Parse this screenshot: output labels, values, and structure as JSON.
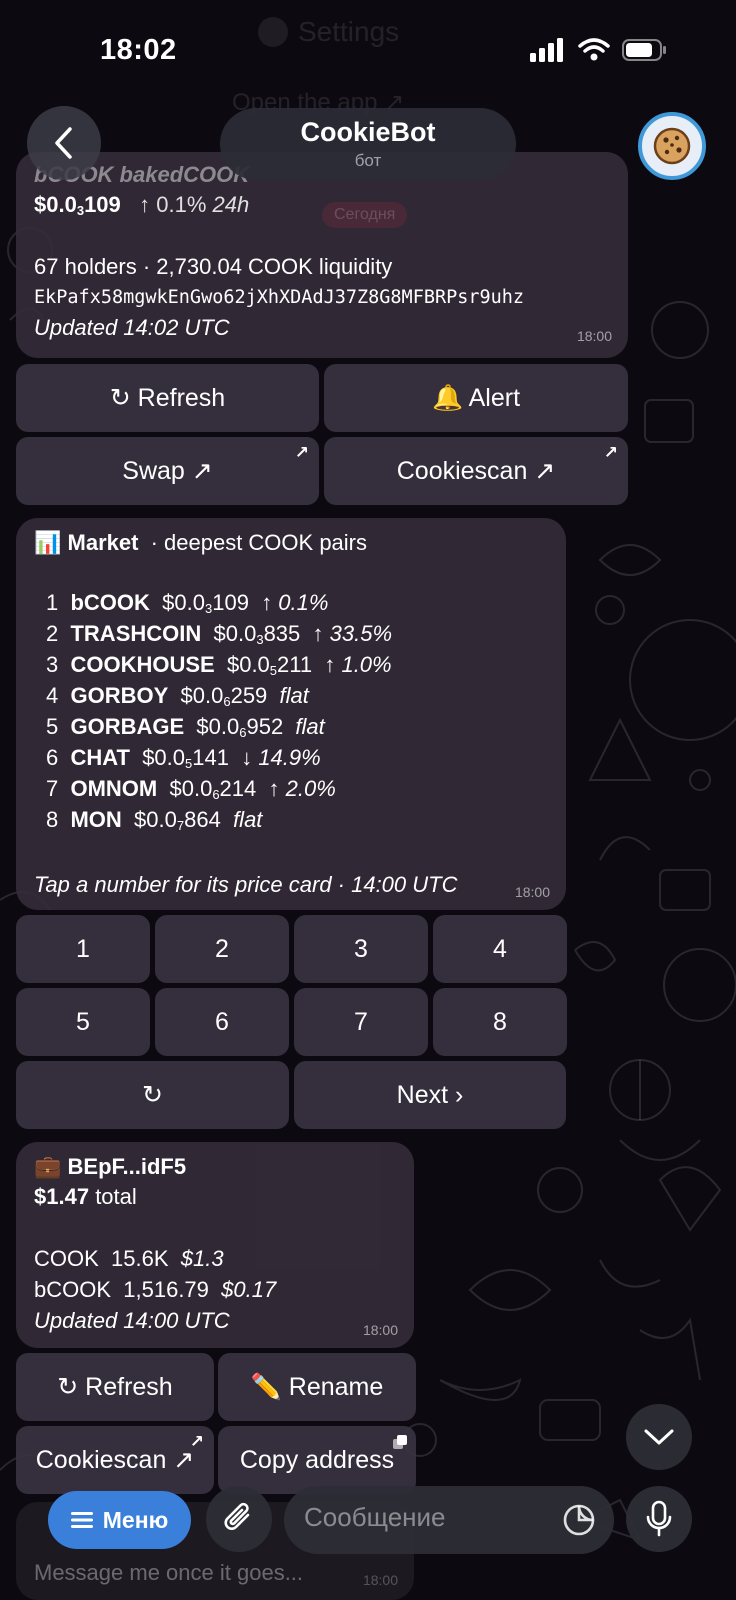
{
  "status_bar": {
    "time": "18:02"
  },
  "background_ghost": {
    "settings": "Settings",
    "open_app": "Open the app ↗"
  },
  "header": {
    "title": "CookieBot",
    "subtitle": "бот"
  },
  "date_chip": "Сегодня",
  "price_card": {
    "top_line": "bCOOK  bakedCOOK",
    "price_prefix": "$0.0",
    "price_sub": "3",
    "price_suffix": "109",
    "change": "↑ 0.1%",
    "change_period": "24h",
    "stats": "67 holders  ·  2,730.04 COOK liquidity",
    "address": "EkPafx58mgwkEnGwo62jXhXDAdJ37Z8G8MFBRPsr9uhz",
    "updated": "Updated 14:02 UTC",
    "time": "18:00"
  },
  "price_buttons": {
    "refresh": "↻ Refresh",
    "alert": "🔔 Alert",
    "swap": "Swap ↗",
    "cookiescan": "Cookiescan ↗",
    "corner": "↗"
  },
  "market": {
    "icon": "📊",
    "title": "Market",
    "subtitle": "·  deepest COOK pairs",
    "rows": [
      {
        "n": "1",
        "sym": "bCOOK",
        "p": "$0.0",
        "s": "3",
        "q": "109",
        "chg": "↑ 0.1%"
      },
      {
        "n": "2",
        "sym": "TRASHCOIN",
        "p": "$0.0",
        "s": "3",
        "q": "835",
        "chg": "↑ 33.5%"
      },
      {
        "n": "3",
        "sym": "COOKHOUSE",
        "p": "$0.0",
        "s": "5",
        "q": "211",
        "chg": "↑ 1.0%"
      },
      {
        "n": "4",
        "sym": "GORBOY",
        "p": "$0.0",
        "s": "6",
        "q": "259",
        "chg": "flat"
      },
      {
        "n": "5",
        "sym": "GORBAGE",
        "p": "$0.0",
        "s": "6",
        "q": "952",
        "chg": "flat"
      },
      {
        "n": "6",
        "sym": "CHAT",
        "p": "$0.0",
        "s": "5",
        "q": "141",
        "chg": "↓ 14.9%"
      },
      {
        "n": "7",
        "sym": "OMNOM",
        "p": "$0.0",
        "s": "6",
        "q": "214",
        "chg": "↑ 2.0%"
      },
      {
        "n": "8",
        "sym": "MON",
        "p": "$0.0",
        "s": "7",
        "q": "864",
        "chg": "flat"
      }
    ],
    "footer": "Tap a number for its price card · 14:00 UTC",
    "time": "18:00"
  },
  "number_buttons": [
    "1",
    "2",
    "3",
    "4",
    "5",
    "6",
    "7",
    "8"
  ],
  "nav_buttons": {
    "refresh": "↻",
    "next": "Next ›"
  },
  "wallet": {
    "icon": "💼",
    "name": "BEpF...idF5",
    "total_value": "$1.47",
    "total_label": "total",
    "holdings": [
      {
        "token": "COOK",
        "amount": "15.6K",
        "value": "$1.3"
      },
      {
        "token": "bCOOK",
        "amount": "1,516.79",
        "value": "$0.17"
      }
    ],
    "updated": "Updated 14:00 UTC",
    "time": "18:00"
  },
  "wallet_buttons": {
    "refresh": "↻ Refresh",
    "rename": "✏️ Rename",
    "cookiescan": "Cookiescan ↗",
    "copy_address": "Copy address"
  },
  "peek_message": {
    "text": "Message me once it goes...",
    "time": "18:00"
  },
  "composer": {
    "menu_label": "Меню",
    "placeholder": "Сообщение"
  },
  "colors": {
    "accent": "#3a7fd9",
    "bubble": "#342c38",
    "avatar_ring": "#3f98d8"
  }
}
